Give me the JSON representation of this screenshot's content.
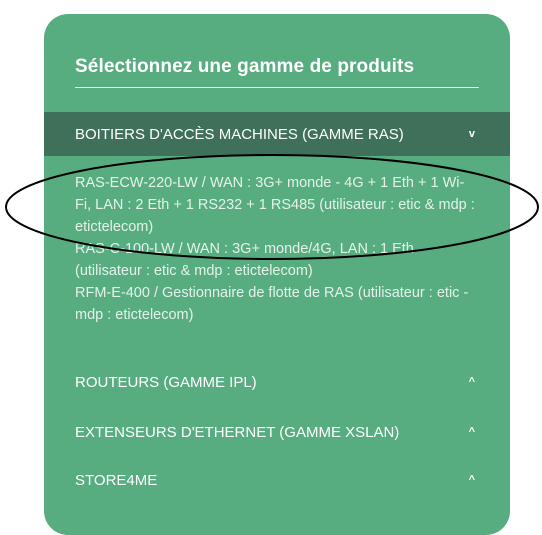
{
  "panel": {
    "title": "Sélectionnez une gamme de produits",
    "background_color": "#57ad80",
    "active_header_color": "#3f7059"
  },
  "categories": [
    {
      "label": "BOITIERS D'ACCÈS MACHINES (GAMME RAS)",
      "chevron": "v",
      "expanded": true
    },
    {
      "label": "ROUTEURS (GAMME IPL)",
      "chevron": "^",
      "expanded": false
    },
    {
      "label": "EXTENSEURS D'ETHERNET (GAMME XSLAN)",
      "chevron": "^",
      "expanded": false
    },
    {
      "label": "STORE4ME",
      "chevron": "^",
      "expanded": false
    }
  ],
  "products": [
    "RAS-ECW-220-LW / WAN : 3G+ monde - 4G + 1 Eth + 1 Wi-Fi, LAN : 2 Eth + 1 RS232 + 1 RS485 (utilisateur : etic & mdp : etictelecom)",
    "RAS-C-100-LW / WAN : 3G+ monde/4G, LAN : 1 Eth (utilisateur : etic & mdp : etictelecom)",
    "RFM-E-400 / Gestionnaire de flotte de RAS (utilisateur : etic - mdp : etictelecom)"
  ]
}
